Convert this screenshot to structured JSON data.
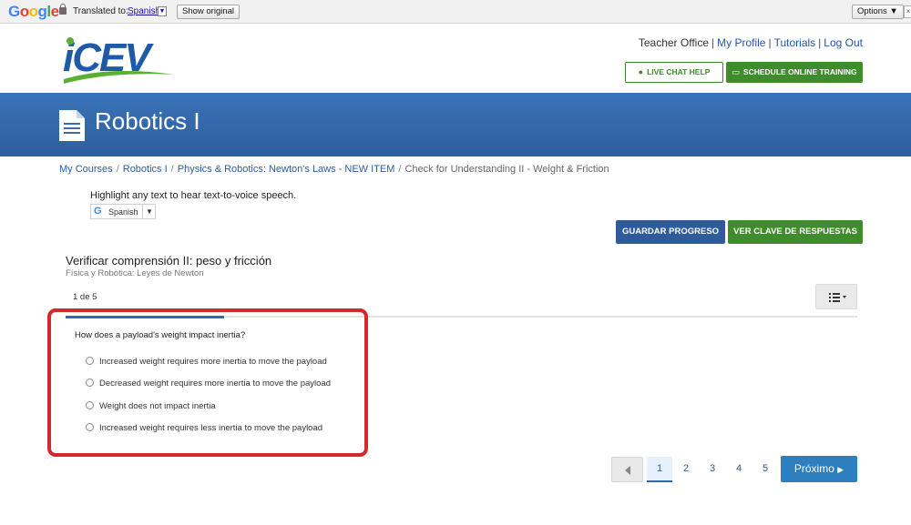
{
  "translate_bar": {
    "logo": "Google",
    "translated_to_label": "Translated to:",
    "language": "Spanish",
    "show_original": "Show original",
    "options": "Options ▼"
  },
  "header": {
    "logo_text": "iCEV",
    "links": [
      "Teacher Office",
      "My Profile",
      "Tutorials",
      "Log Out"
    ],
    "chat_button": "LIVE CHAT HELP",
    "training_button": "SCHEDULE ONLINE TRAINING"
  },
  "banner": {
    "title": "Robotics I"
  },
  "breadcrumb": {
    "items": [
      "My Courses",
      "Robotics I",
      "Physics & Robotics: Newton's Laws - NEW ITEM"
    ],
    "current": "Check for Understanding II - Weight & Friction"
  },
  "tts": {
    "hint": "Highlight any text to hear text-to-voice speech.",
    "language": "Spanish"
  },
  "actions": {
    "save": "GUARDAR PROGRESO",
    "answer_key": "VER CLAVE DE RESPUESTAS"
  },
  "quiz": {
    "title": "Verificar comprensión II: peso y fricción",
    "subtitle": "Física y Robótica: Leyes de Newton",
    "counter": "1 de 5",
    "progress_fraction": 0.2,
    "question": "How does a payload's weight impact inertia?",
    "options": [
      "Increased weight requires more inertia to move the payload",
      "Decreased weight requires more inertia to move the payload",
      "Weight does not impact inertia",
      "Increased weight requires less inertia to move the payload"
    ]
  },
  "pagination": {
    "pages": [
      "1",
      "2",
      "3",
      "4",
      "5"
    ],
    "active_page": "1",
    "next": "Próximo"
  },
  "colors": {
    "banner_blue": "#2d5e9e",
    "accent_green": "#3f8c2c",
    "highlight_red": "#d4282f",
    "next_blue": "#2e7fc0"
  }
}
